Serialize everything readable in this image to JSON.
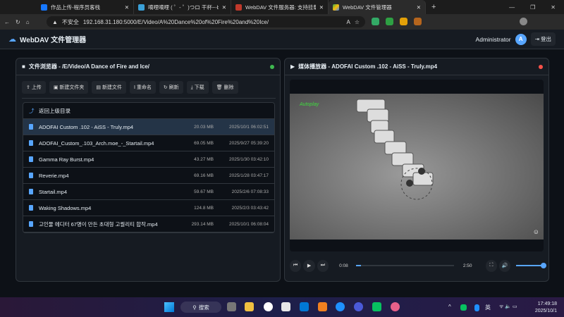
{
  "browser": {
    "tabs": [
      {
        "title": "作品上传-程序员客栈"
      },
      {
        "title": "嘀哩嘀哩 ( ゜- ゜)つロ 干杯~-bilibili"
      },
      {
        "title": "WebDAV 文件服务器: 支持挂载用"
      },
      {
        "title": "WebDAV 文件管理器"
      }
    ],
    "security": "不安全",
    "url": "192.168.31.180:5000/E/Video/A%20Dance%20of%20Fire%20and%20Ice/"
  },
  "app": {
    "title": "WebDAV 文件管理器",
    "user": "Administrator",
    "avatar": "A",
    "logout": "登出"
  },
  "browser_panel": {
    "title": "文件浏览器 - /E/Video/A Dance of Fire and Ice/",
    "status_color": "#3fb950",
    "toolbar": [
      "上传",
      "新建文件夹",
      "新建文件",
      "重命名",
      "刷新",
      "下载",
      "删除"
    ],
    "parent": "返回上级目录",
    "files": [
      {
        "name": "ADOFAI Custom .102 - AiSS - Truly.mp4",
        "size": "20.03 MB",
        "date": "2025/10/1 06:02:51",
        "selected": true
      },
      {
        "name": "ADOFAI_Custom_.103_Arch.moe_-_Startail.mp4",
        "size": "69.05 MB",
        "date": "2025/9/27 05:39:20"
      },
      {
        "name": "Gamma Ray Burst.mp4",
        "size": "43.27 MB",
        "date": "2025/1/30 03:42:10"
      },
      {
        "name": "Reverie.mp4",
        "size": "69.16 MB",
        "date": "2025/1/28 03:47:17"
      },
      {
        "name": "Startail.mp4",
        "size": "59.67 MB",
        "date": "2025/2/6 07:08:33"
      },
      {
        "name": "Waking Shadows.mp4",
        "size": "124.8 MB",
        "date": "2025/2/3 03:43:42"
      },
      {
        "name": "고인물 에디터 67명이 만든 초대형 고퀄리티 합작.mp4",
        "size": "293.14 MB",
        "date": "2025/10/1 06:08:04"
      }
    ]
  },
  "player": {
    "title": "媒体播放器 - ADOFAI Custom .102 - AiSS - Truly.mp4",
    "status_color": "#f85149",
    "overlay_text": "Autoplay",
    "current": "0:08",
    "duration": "2:50",
    "progress": 0.047,
    "volume": 1.0
  },
  "taskbar": {
    "search": "搜索",
    "ime": "英",
    "time": "17:49:18",
    "date": "2025/10/1"
  }
}
